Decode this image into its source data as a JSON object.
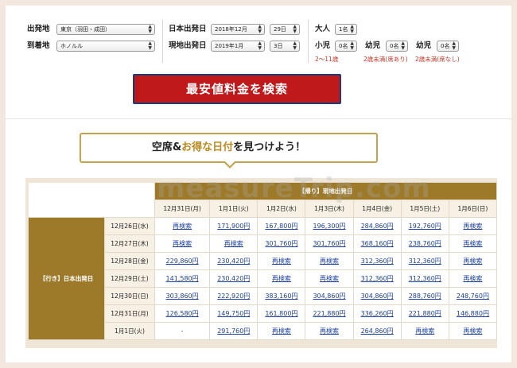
{
  "form": {
    "departure_label": "出発地",
    "departure_value": "東京（羽田・成田）",
    "arrival_label": "到着地",
    "arrival_value": "ホノルル",
    "jp_date_label": "日本出発日",
    "jp_month": "2018年12月",
    "jp_day": "29日",
    "local_date_label": "現地出発日",
    "local_month": "2019年1月",
    "local_day": "3日",
    "adult_label": "大人",
    "adult_value": "1名",
    "child_label": "小児",
    "child_value": "0名",
    "child_note": "2〜11歳",
    "infant1_label": "幼児",
    "infant1_value": "0名",
    "infant1_note": "2歳未満(席あり)",
    "infant2_label": "幼児",
    "infant2_value": "0名",
    "infant2_note": "2歳未満(席なし)"
  },
  "search_button": "最安値料金を検索",
  "callout": {
    "part1": "空席&",
    "part2": "お得な日付",
    "part3": "を見つけよう！"
  },
  "watermark": "measureTrip.com",
  "table": {
    "return_header": "【帰り】現地出発日",
    "go_header": "【行き】日本出発日",
    "return_dates": [
      "12月31日(月)",
      "1月1日(火)",
      "1月2日(水)",
      "1月3日(木)",
      "1月4日(金)",
      "1月5日(土)",
      "1月6日(日)"
    ],
    "rows": [
      {
        "date": "12月26日(水)",
        "cells": [
          "再検索",
          "171,900円",
          "167,800円",
          "196,300円",
          "284,860円",
          "192,760円",
          "再検索"
        ]
      },
      {
        "date": "12月27日(木)",
        "cells": [
          "再検索",
          "再検索",
          "301,760円",
          "301,760円",
          "368,160円",
          "238,760円",
          "再検索"
        ]
      },
      {
        "date": "12月28日(金)",
        "cells": [
          "229,860円",
          "230,420円",
          "再検索",
          "再検索",
          "312,360円",
          "312,360円",
          "再検索"
        ]
      },
      {
        "date": "12月29日(土)",
        "cells": [
          "141,580円",
          "230,420円",
          "再検索",
          "再検索",
          "312,360円",
          "312,360円",
          "再検索"
        ]
      },
      {
        "date": "12月30日(日)",
        "cells": [
          "303,860円",
          "222,920円",
          "383,160円",
          "304,860円",
          "304,860円",
          "288,760円",
          "248,760円"
        ]
      },
      {
        "date": "12月31日(月)",
        "cells": [
          "126,580円",
          "149,750円",
          "161,800円",
          "221,880円",
          "336,260円",
          "221,880円",
          "146,880円"
        ]
      },
      {
        "date": "1月1日(火)",
        "cells": [
          "-",
          "291,760円",
          "再検索",
          "再検索",
          "264,860円",
          "再検索",
          "再検索"
        ]
      }
    ]
  },
  "colors": {
    "accent_gold": "#9d7a2a",
    "button_red": "#c0191c",
    "link_blue": "#1a3fa0",
    "note_red": "#c0392b",
    "page_bg": "#f3e7df"
  }
}
